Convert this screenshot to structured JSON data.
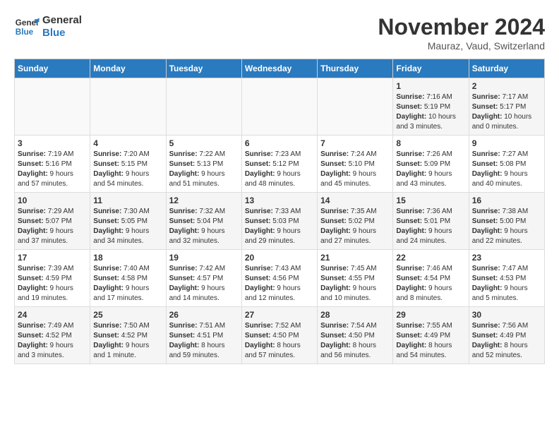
{
  "header": {
    "logo_line1": "General",
    "logo_line2": "Blue",
    "month": "November 2024",
    "location": "Mauraz, Vaud, Switzerland"
  },
  "weekdays": [
    "Sunday",
    "Monday",
    "Tuesday",
    "Wednesday",
    "Thursday",
    "Friday",
    "Saturday"
  ],
  "weeks": [
    [
      {
        "day": "",
        "info": ""
      },
      {
        "day": "",
        "info": ""
      },
      {
        "day": "",
        "info": ""
      },
      {
        "day": "",
        "info": ""
      },
      {
        "day": "",
        "info": ""
      },
      {
        "day": "1",
        "info": "Sunrise: 7:16 AM\nSunset: 5:19 PM\nDaylight: 10 hours and 3 minutes."
      },
      {
        "day": "2",
        "info": "Sunrise: 7:17 AM\nSunset: 5:17 PM\nDaylight: 10 hours and 0 minutes."
      }
    ],
    [
      {
        "day": "3",
        "info": "Sunrise: 7:19 AM\nSunset: 5:16 PM\nDaylight: 9 hours and 57 minutes."
      },
      {
        "day": "4",
        "info": "Sunrise: 7:20 AM\nSunset: 5:15 PM\nDaylight: 9 hours and 54 minutes."
      },
      {
        "day": "5",
        "info": "Sunrise: 7:22 AM\nSunset: 5:13 PM\nDaylight: 9 hours and 51 minutes."
      },
      {
        "day": "6",
        "info": "Sunrise: 7:23 AM\nSunset: 5:12 PM\nDaylight: 9 hours and 48 minutes."
      },
      {
        "day": "7",
        "info": "Sunrise: 7:24 AM\nSunset: 5:10 PM\nDaylight: 9 hours and 45 minutes."
      },
      {
        "day": "8",
        "info": "Sunrise: 7:26 AM\nSunset: 5:09 PM\nDaylight: 9 hours and 43 minutes."
      },
      {
        "day": "9",
        "info": "Sunrise: 7:27 AM\nSunset: 5:08 PM\nDaylight: 9 hours and 40 minutes."
      }
    ],
    [
      {
        "day": "10",
        "info": "Sunrise: 7:29 AM\nSunset: 5:07 PM\nDaylight: 9 hours and 37 minutes."
      },
      {
        "day": "11",
        "info": "Sunrise: 7:30 AM\nSunset: 5:05 PM\nDaylight: 9 hours and 34 minutes."
      },
      {
        "day": "12",
        "info": "Sunrise: 7:32 AM\nSunset: 5:04 PM\nDaylight: 9 hours and 32 minutes."
      },
      {
        "day": "13",
        "info": "Sunrise: 7:33 AM\nSunset: 5:03 PM\nDaylight: 9 hours and 29 minutes."
      },
      {
        "day": "14",
        "info": "Sunrise: 7:35 AM\nSunset: 5:02 PM\nDaylight: 9 hours and 27 minutes."
      },
      {
        "day": "15",
        "info": "Sunrise: 7:36 AM\nSunset: 5:01 PM\nDaylight: 9 hours and 24 minutes."
      },
      {
        "day": "16",
        "info": "Sunrise: 7:38 AM\nSunset: 5:00 PM\nDaylight: 9 hours and 22 minutes."
      }
    ],
    [
      {
        "day": "17",
        "info": "Sunrise: 7:39 AM\nSunset: 4:59 PM\nDaylight: 9 hours and 19 minutes."
      },
      {
        "day": "18",
        "info": "Sunrise: 7:40 AM\nSunset: 4:58 PM\nDaylight: 9 hours and 17 minutes."
      },
      {
        "day": "19",
        "info": "Sunrise: 7:42 AM\nSunset: 4:57 PM\nDaylight: 9 hours and 14 minutes."
      },
      {
        "day": "20",
        "info": "Sunrise: 7:43 AM\nSunset: 4:56 PM\nDaylight: 9 hours and 12 minutes."
      },
      {
        "day": "21",
        "info": "Sunrise: 7:45 AM\nSunset: 4:55 PM\nDaylight: 9 hours and 10 minutes."
      },
      {
        "day": "22",
        "info": "Sunrise: 7:46 AM\nSunset: 4:54 PM\nDaylight: 9 hours and 8 minutes."
      },
      {
        "day": "23",
        "info": "Sunrise: 7:47 AM\nSunset: 4:53 PM\nDaylight: 9 hours and 5 minutes."
      }
    ],
    [
      {
        "day": "24",
        "info": "Sunrise: 7:49 AM\nSunset: 4:52 PM\nDaylight: 9 hours and 3 minutes."
      },
      {
        "day": "25",
        "info": "Sunrise: 7:50 AM\nSunset: 4:52 PM\nDaylight: 9 hours and 1 minute."
      },
      {
        "day": "26",
        "info": "Sunrise: 7:51 AM\nSunset: 4:51 PM\nDaylight: 8 hours and 59 minutes."
      },
      {
        "day": "27",
        "info": "Sunrise: 7:52 AM\nSunset: 4:50 PM\nDaylight: 8 hours and 57 minutes."
      },
      {
        "day": "28",
        "info": "Sunrise: 7:54 AM\nSunset: 4:50 PM\nDaylight: 8 hours and 56 minutes."
      },
      {
        "day": "29",
        "info": "Sunrise: 7:55 AM\nSunset: 4:49 PM\nDaylight: 8 hours and 54 minutes."
      },
      {
        "day": "30",
        "info": "Sunrise: 7:56 AM\nSunset: 4:49 PM\nDaylight: 8 hours and 52 minutes."
      }
    ]
  ]
}
